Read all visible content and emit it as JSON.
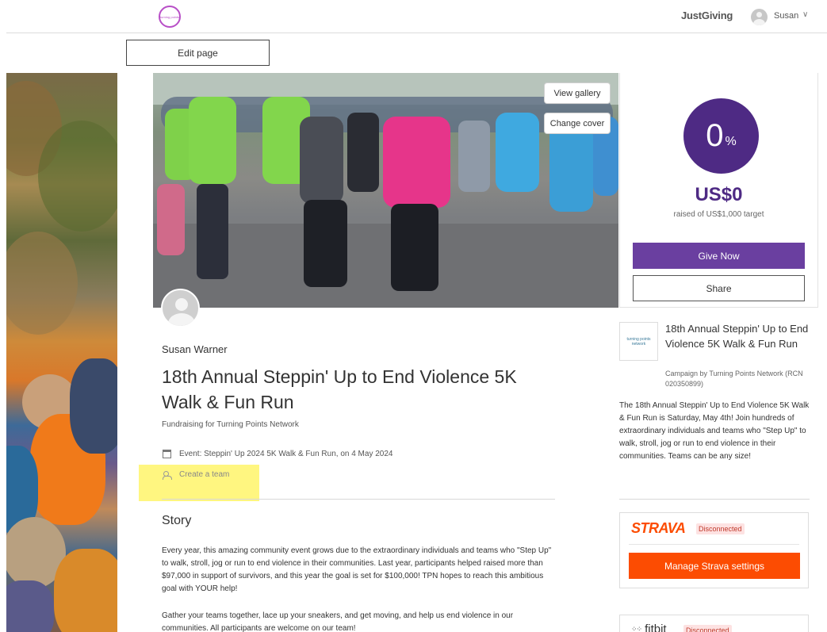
{
  "header": {
    "charity_logo_text": "turning points",
    "brand": "JustGiving",
    "user_name": "Susan",
    "chevron": "∨"
  },
  "toolbar": {
    "edit_page": "Edit page"
  },
  "cover": {
    "view_gallery": "View gallery",
    "change_cover": "Change cover"
  },
  "progress": {
    "percent_value": "0",
    "percent_sign": "%",
    "fraction": 0,
    "raised": "US$0",
    "raised_of": "raised of US$1,000 target",
    "give_now": "Give Now",
    "share": "Share"
  },
  "page": {
    "owner_name": "Susan Warner",
    "title": "18th Annual Steppin' Up to End Violence 5K Walk & Fun Run",
    "fundraising_for": "Fundraising for Turning Points Network",
    "event": "Event: Steppin' Up 2024 5K Walk & Fun Run, on 4 May 2024",
    "create_team": "Create a team"
  },
  "story": {
    "heading": "Story",
    "p1": "Every year, this amazing community event grows due to the extraordinary individuals and teams who \"Step Up\" to walk, stroll, jog or run to end violence in their communities. Last year, participants helped raised more than $97,000 in support of survivors, and this year the goal is set for $100,000! TPN hopes to reach this ambitious goal with YOUR help!",
    "p2": "Gather your teams together, lace up your sneakers, and get moving, and help us end violence in our communities. All participants are welcome on our team!"
  },
  "charity": {
    "logo_text": "turning points network",
    "title": "18th Annual Steppin' Up to End Violence 5K Walk & Fun Run",
    "campaign_by": "Campaign by Turning Points Network (RCN 020350899)",
    "description": "The 18th Annual Steppin' Up to End Violence 5K Walk & Fun Run is Saturday, May 4th! Join hundreds of extraordinary individuals and teams who \"Step Up\" to walk, stroll, jog or run to end violence in their communities. Teams can be any size!"
  },
  "integrations": {
    "strava_name": "STRAVA",
    "strava_status": "Disconnected",
    "strava_manage": "Manage Strava settings",
    "fitbit_name": "fitbit",
    "fitbit_status": "Disconnected"
  },
  "colors": {
    "brand_purple": "#4e2a84",
    "give_now_purple": "#6a3fa0",
    "strava_orange": "#fc4c02",
    "highlight_yellow": "#fff680"
  }
}
